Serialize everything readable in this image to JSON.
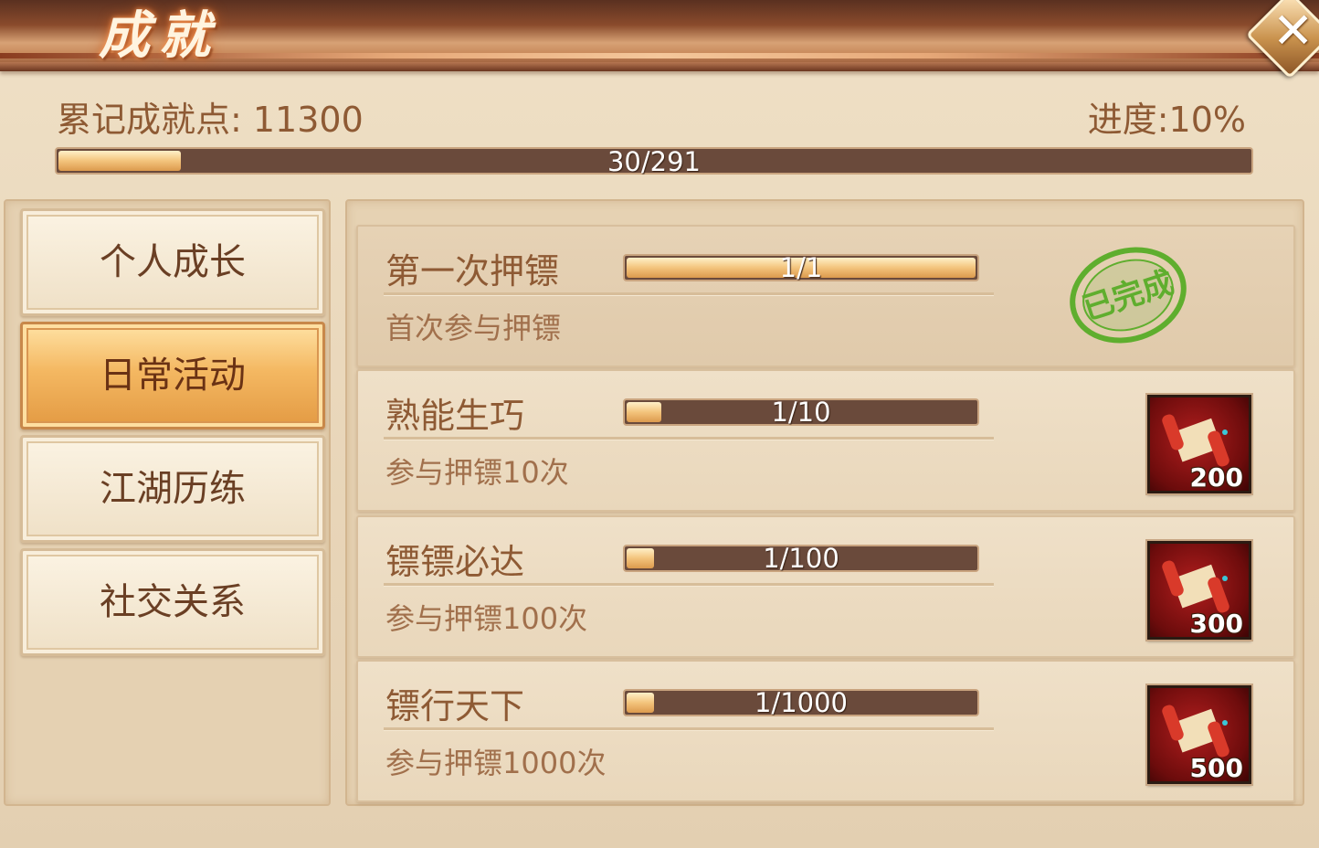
{
  "window": {
    "title": "成就",
    "close_icon": "close-x-icon"
  },
  "summary": {
    "points_label": "累记成就点: 11300",
    "progress_label": "进度:10%",
    "bar_text": "30/291",
    "bar_fraction": 0.1031
  },
  "tabs": [
    {
      "label": "个人成长",
      "active": false
    },
    {
      "label": "日常活动",
      "active": true
    },
    {
      "label": "江湖历练",
      "active": false
    },
    {
      "label": "社交关系",
      "active": false
    }
  ],
  "achievements": [
    {
      "name": "第一次押镖",
      "progress_text": "1/1",
      "progress_fraction": 1.0,
      "description": "首次参与押镖",
      "status": "已完成",
      "status_icon": "completed-stamp-icon"
    },
    {
      "name": "熟能生巧",
      "progress_text": "1/10",
      "progress_fraction": 0.1,
      "description": "参与押镖10次",
      "reward_icon": "scroll-icon",
      "reward_count": "200"
    },
    {
      "name": "镖镖必达",
      "progress_text": "1/100",
      "progress_fraction": 0.01,
      "description": "参与押镖100次",
      "reward_icon": "scroll-icon",
      "reward_count": "300"
    },
    {
      "name": "镖行天下",
      "progress_text": "1/1000",
      "progress_fraction": 0.001,
      "description": "参与押镖1000次",
      "reward_icon": "scroll-icon",
      "reward_count": "500"
    }
  ],
  "colors": {
    "accent_gold": "#f3c47c",
    "bar_track": "#6a4a3b",
    "text_brown": "#8e5a34",
    "stamp_green": "#5fae2e"
  }
}
